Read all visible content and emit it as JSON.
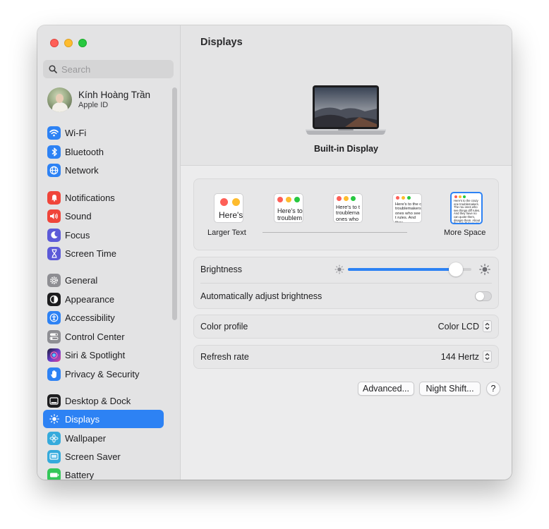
{
  "sidebar": {
    "search_placeholder": "Search",
    "account": {
      "name": "Kính Hoàng Trần",
      "subtitle": "Apple ID"
    },
    "items": [
      {
        "label": "Wi-Fi",
        "icon": "wifi-icon",
        "color": "#2d82f4"
      },
      {
        "label": "Bluetooth",
        "icon": "bluetooth-icon",
        "color": "#2d82f4"
      },
      {
        "label": "Network",
        "icon": "globe-icon",
        "color": "#2d82f4"
      },
      {
        "label": "Notifications",
        "icon": "bell-icon",
        "color": "#f0453a"
      },
      {
        "label": "Sound",
        "icon": "speaker-icon",
        "color": "#f0453a"
      },
      {
        "label": "Focus",
        "icon": "moon-icon",
        "color": "#5c5ad8"
      },
      {
        "label": "Screen Time",
        "icon": "hourglass-icon",
        "color": "#5c5ad8"
      },
      {
        "label": "General",
        "icon": "gear-icon",
        "color": "#8e8e93"
      },
      {
        "label": "Appearance",
        "icon": "appearance-icon",
        "color": "#1d1d1f"
      },
      {
        "label": "Accessibility",
        "icon": "accessibility-icon",
        "color": "#2d82f4"
      },
      {
        "label": "Control Center",
        "icon": "toggles-icon",
        "color": "#8e8e93"
      },
      {
        "label": "Siri & Spotlight",
        "icon": "siri-icon",
        "color": "#7b4fd6"
      },
      {
        "label": "Privacy & Security",
        "icon": "hand-icon",
        "color": "#2d82f4"
      },
      {
        "label": "Desktop & Dock",
        "icon": "dock-icon",
        "color": "#1d1d1f"
      },
      {
        "label": "Displays",
        "icon": "sun-icon",
        "color": "#2d82f4",
        "selected": true
      },
      {
        "label": "Wallpaper",
        "icon": "flower-icon",
        "color": "#35aadc"
      },
      {
        "label": "Screen Saver",
        "icon": "screen-saver-icon",
        "color": "#35aadc"
      },
      {
        "label": "Battery",
        "icon": "battery-icon",
        "color": "#34c759"
      }
    ]
  },
  "main": {
    "title": "Displays",
    "display_name": "Built-in Display",
    "resolution": {
      "left_label": "Larger Text",
      "right_label": "More Space",
      "option1_text": "Here's",
      "option2_text": "Here's to troublem",
      "option3_text": "Here's to t troublema ones who",
      "option4_text": "Here's to the c troublemakers. ones who see t rules. And they",
      "option5_text": "Here's to the crazy one troublemakers. The rou ones who see things diff rules. And they have no can quote them, disagre them. About the only th because they change th",
      "selected_index": 5
    },
    "brightness": {
      "label": "Brightness",
      "value": 0.92
    },
    "auto_brightness": {
      "label": "Automatically adjust brightness",
      "enabled": false
    },
    "color_profile": {
      "label": "Color profile",
      "value": "Color LCD"
    },
    "refresh_rate": {
      "label": "Refresh rate",
      "value": "144 Hertz"
    },
    "buttons": {
      "advanced": "Advanced...",
      "night_shift": "Night Shift...",
      "help": "?"
    }
  },
  "colors": {
    "accent": "#2d82f4",
    "close": "#fe5f57",
    "minimize": "#febc2e",
    "zoom": "#28c840"
  }
}
